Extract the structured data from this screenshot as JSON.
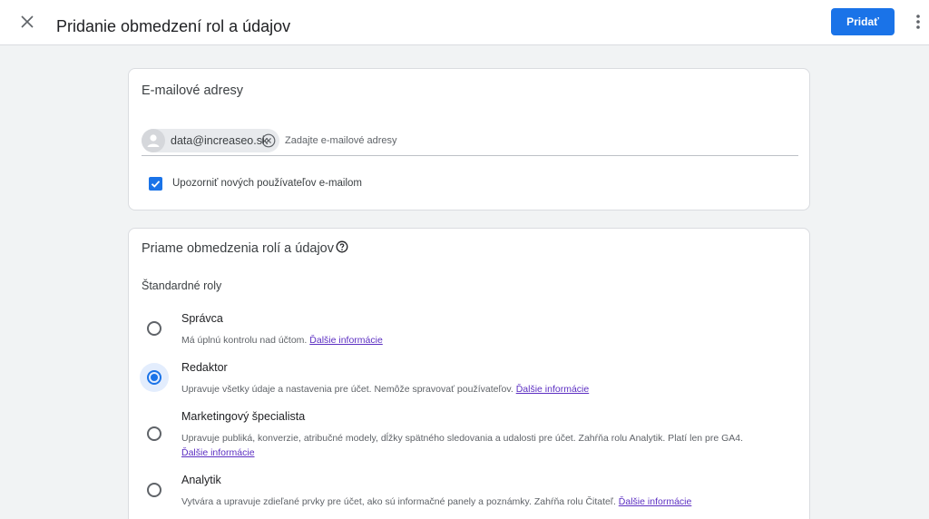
{
  "header": {
    "title": "Pridanie obmedzení rol a údajov",
    "add_label": "Pridať"
  },
  "emails": {
    "heading": "E-mailové adresy",
    "chip_label": "data@increaseo.sk",
    "placeholder": "Zadajte e-mailové adresy",
    "notify_label": "Upozorniť nových používateľov e-mailom",
    "notify_checked": true
  },
  "roles": {
    "heading": "Priame obmedzenia rolí a údajov",
    "standard_heading": "Štandardné roly",
    "learn_more": "Ďalšie informácie",
    "items": [
      {
        "name": "Správca",
        "desc": "Má úplnú kontrolu nad účtom.",
        "selected": false
      },
      {
        "name": "Redaktor",
        "desc": "Upravuje všetky údaje a nastavenia pre účet. Nemôže spravovať používateľov.",
        "selected": true
      },
      {
        "name": "Marketingový špecialista",
        "desc": "Upravuje publiká, konverzie, atribučné modely, dĺžky spätného sledovania a udalosti pre účet. Zahŕňa rolu Analytik. Platí len pre GA4.",
        "selected": false
      },
      {
        "name": "Analytik",
        "desc": "Vytvára a upravuje zdieľané prvky pre účet, ako sú informačné panely a poznámky. Zahŕňa rolu Čitateľ.",
        "selected": false
      }
    ]
  },
  "colors": {
    "accent": "#1a73e8",
    "link": "#5c2fc2"
  },
  "icons": [
    "close-icon",
    "more-vert-icon",
    "person-icon",
    "cancel-icon",
    "check-icon",
    "help-icon"
  ]
}
